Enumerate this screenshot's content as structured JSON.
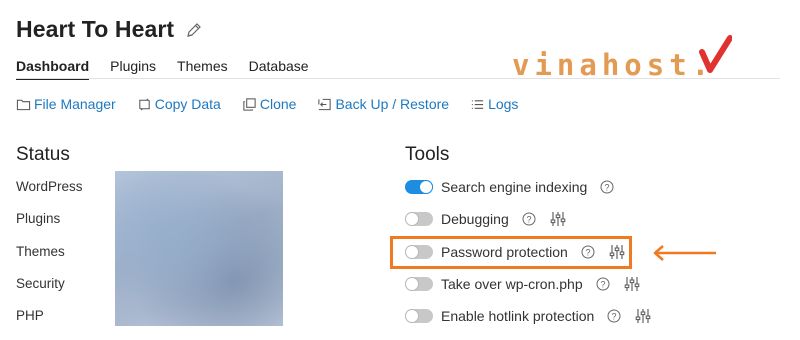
{
  "site": {
    "title": "Heart To Heart"
  },
  "logo": {
    "text": "vinahost."
  },
  "tabs": [
    {
      "label": "Dashboard"
    },
    {
      "label": "Plugins"
    },
    {
      "label": "Themes"
    },
    {
      "label": "Database"
    }
  ],
  "actions": [
    {
      "label": "File Manager",
      "icon": "folder-icon"
    },
    {
      "label": "Copy Data",
      "icon": "copy-data-icon"
    },
    {
      "label": "Clone",
      "icon": "clone-icon"
    },
    {
      "label": "Back Up / Restore",
      "icon": "backup-icon"
    },
    {
      "label": "Logs",
      "icon": "list-icon"
    }
  ],
  "status": {
    "title": "Status",
    "labels": [
      "WordPress",
      "Plugins",
      "Themes",
      "Security",
      "PHP"
    ]
  },
  "tools": {
    "title": "Tools",
    "items": [
      {
        "label": "Search engine indexing",
        "on": true
      },
      {
        "label": "Debugging",
        "on": false
      },
      {
        "label": "Password protection",
        "on": false
      },
      {
        "label": "Take over wp-cron.php",
        "on": false
      },
      {
        "label": "Enable hotlink protection",
        "on": false
      }
    ]
  },
  "colors": {
    "accent": "#1e79bf",
    "toggle_on": "#1e8ce0",
    "highlight": "#ef7a22",
    "logo": "#e39a52"
  }
}
